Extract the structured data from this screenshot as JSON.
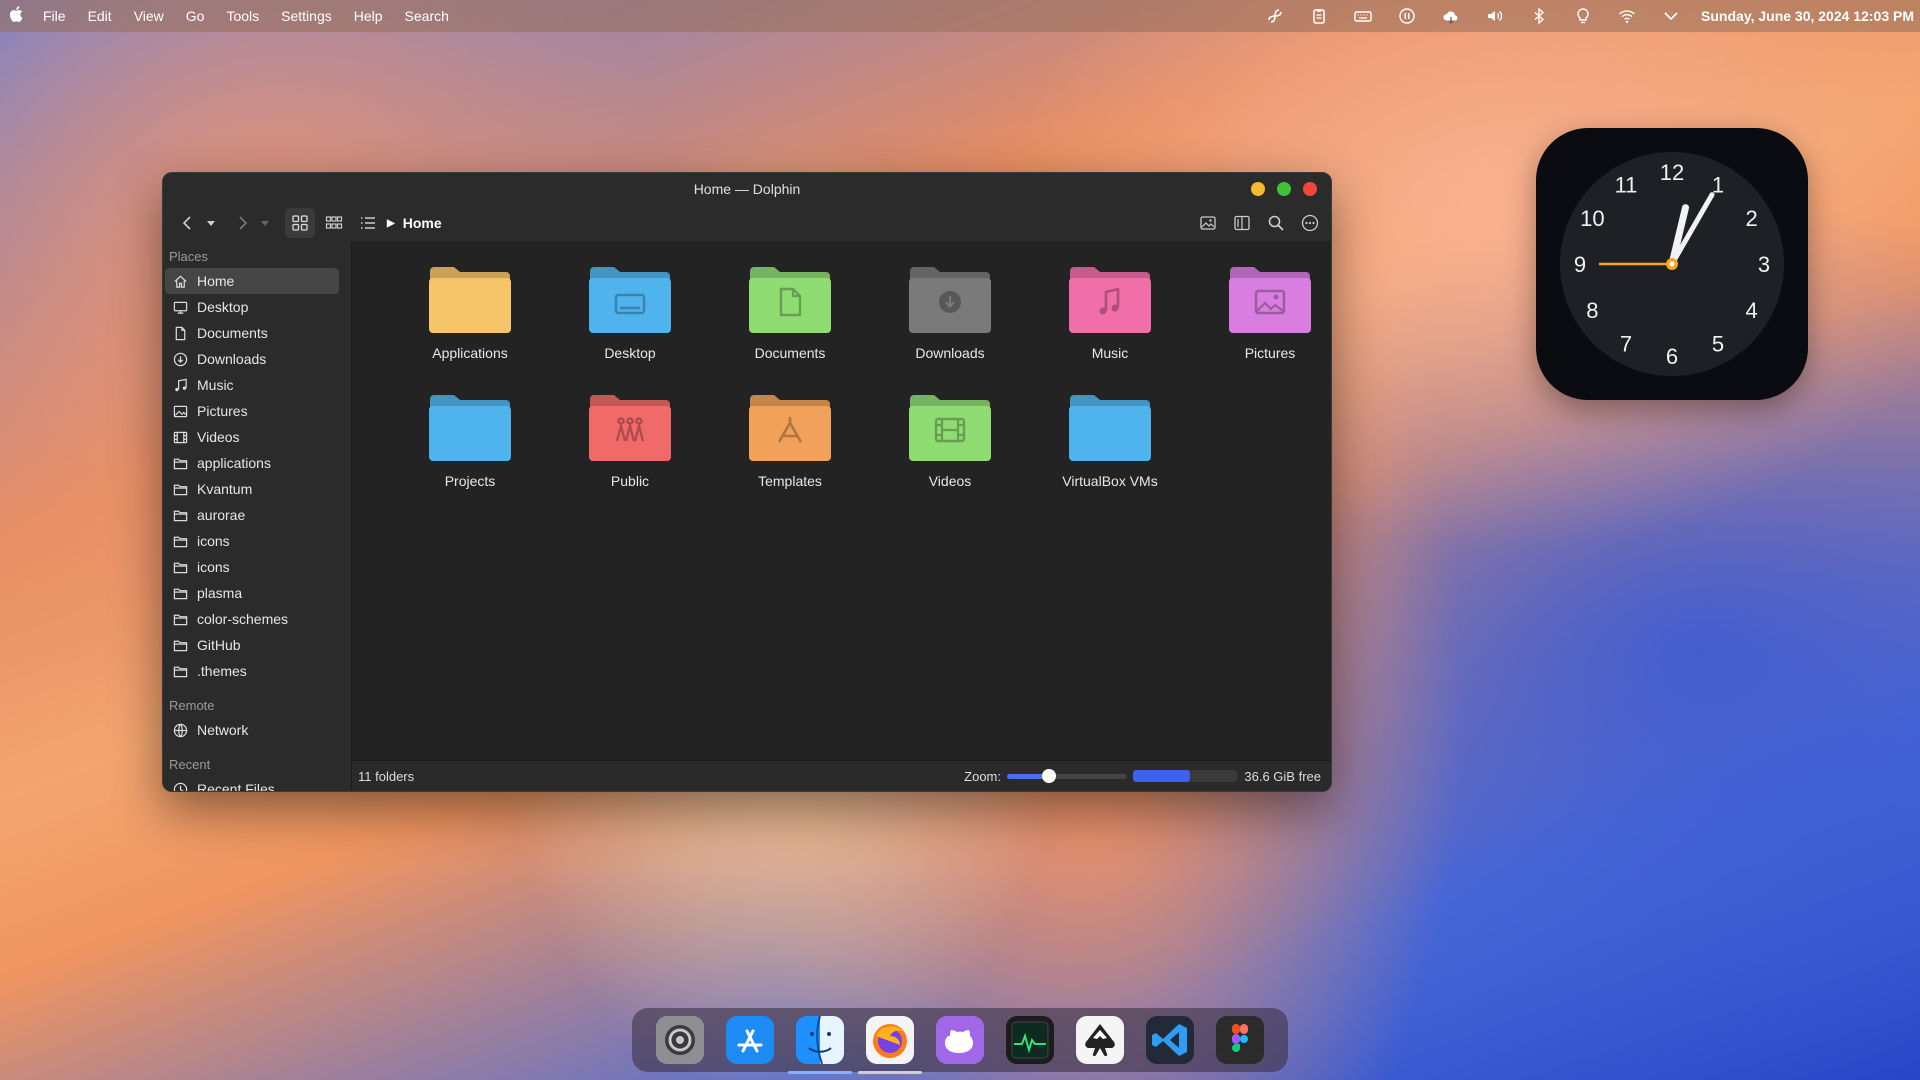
{
  "menubar": {
    "menus": [
      "File",
      "Edit",
      "View",
      "Go",
      "Tools",
      "Settings",
      "Help",
      "Search"
    ],
    "tray_icons": [
      "fan-icon",
      "clipboard-icon",
      "keyboard-icon",
      "pause-icon",
      "cloud-icon",
      "volume-icon",
      "bluetooth-icon",
      "lightbulb-icon",
      "wifi-icon",
      "chevron-down-icon"
    ],
    "datetime": "Sunday, June 30, 2024 12:03 PM"
  },
  "window": {
    "title": "Home — Dolphin",
    "breadcrumb": "Home",
    "sidebar": {
      "places_title": "Places",
      "places": [
        {
          "label": "Home",
          "icon": "home-icon",
          "selected": true
        },
        {
          "label": "Desktop",
          "icon": "desktop-icon"
        },
        {
          "label": "Documents",
          "icon": "document-icon"
        },
        {
          "label": "Downloads",
          "icon": "download-icon"
        },
        {
          "label": "Music",
          "icon": "music-icon"
        },
        {
          "label": "Pictures",
          "icon": "image-icon"
        },
        {
          "label": "Videos",
          "icon": "film-icon"
        },
        {
          "label": "applications",
          "icon": "folder-icon"
        },
        {
          "label": "Kvantum",
          "icon": "folder-icon"
        },
        {
          "label": "aurorae",
          "icon": "folder-icon"
        },
        {
          "label": "icons",
          "icon": "folder-icon"
        },
        {
          "label": "icons",
          "icon": "folder-icon"
        },
        {
          "label": "plasma",
          "icon": "folder-icon"
        },
        {
          "label": "color-schemes",
          "icon": "folder-icon"
        },
        {
          "label": "GitHub",
          "icon": "folder-icon"
        },
        {
          "label": ".themes",
          "icon": "folder-icon"
        }
      ],
      "remote_title": "Remote",
      "remote": [
        {
          "label": "Network",
          "icon": "network-icon"
        }
      ],
      "recent_title": "Recent",
      "recent": [
        {
          "label": "Recent Files",
          "icon": "recent-icon"
        }
      ]
    },
    "folders": [
      {
        "label": "Applications",
        "color": "#f6c56a",
        "emblem": "none"
      },
      {
        "label": "Desktop",
        "color": "#4fb4ee",
        "emblem": "desktop"
      },
      {
        "label": "Documents",
        "color": "#8fdc73",
        "emblem": "document"
      },
      {
        "label": "Downloads",
        "color": "#7a7a7a",
        "emblem": "download"
      },
      {
        "label": "Music",
        "color": "#f06fa8",
        "emblem": "music"
      },
      {
        "label": "Pictures",
        "color": "#d77ee0",
        "emblem": "image"
      },
      {
        "label": "Projects",
        "color": "#4fb4ee",
        "emblem": "none"
      },
      {
        "label": "Public",
        "color": "#f06a6a",
        "emblem": "people"
      },
      {
        "label": "Templates",
        "color": "#f2a15a",
        "emblem": "template"
      },
      {
        "label": "Videos",
        "color": "#8fdc73",
        "emblem": "film"
      },
      {
        "label": "VirtualBox VMs",
        "color": "#4fb4ee",
        "emblem": "none"
      }
    ],
    "status": {
      "count": "11 folders",
      "zoom_label": "Zoom:",
      "zoom_fraction": 0.35,
      "space_used_fraction": 0.55,
      "free": "36.6 GiB free"
    }
  },
  "clock": {
    "numbers": [
      "12",
      "1",
      "2",
      "3",
      "4",
      "5",
      "6",
      "7",
      "8",
      "9",
      "10",
      "11"
    ],
    "hour": 12,
    "minute": 3,
    "second": 45
  },
  "dock": {
    "apps": [
      {
        "name": "settings-app-icon",
        "state": ""
      },
      {
        "name": "app-store-icon",
        "state": ""
      },
      {
        "name": "finder-icon",
        "state": "active"
      },
      {
        "name": "firefox-icon",
        "state": "running"
      },
      {
        "name": "github-icon",
        "state": ""
      },
      {
        "name": "activity-monitor-icon",
        "state": ""
      },
      {
        "name": "inkscape-icon",
        "state": ""
      },
      {
        "name": "vscode-icon",
        "state": ""
      },
      {
        "name": "figma-icon",
        "state": ""
      }
    ]
  }
}
